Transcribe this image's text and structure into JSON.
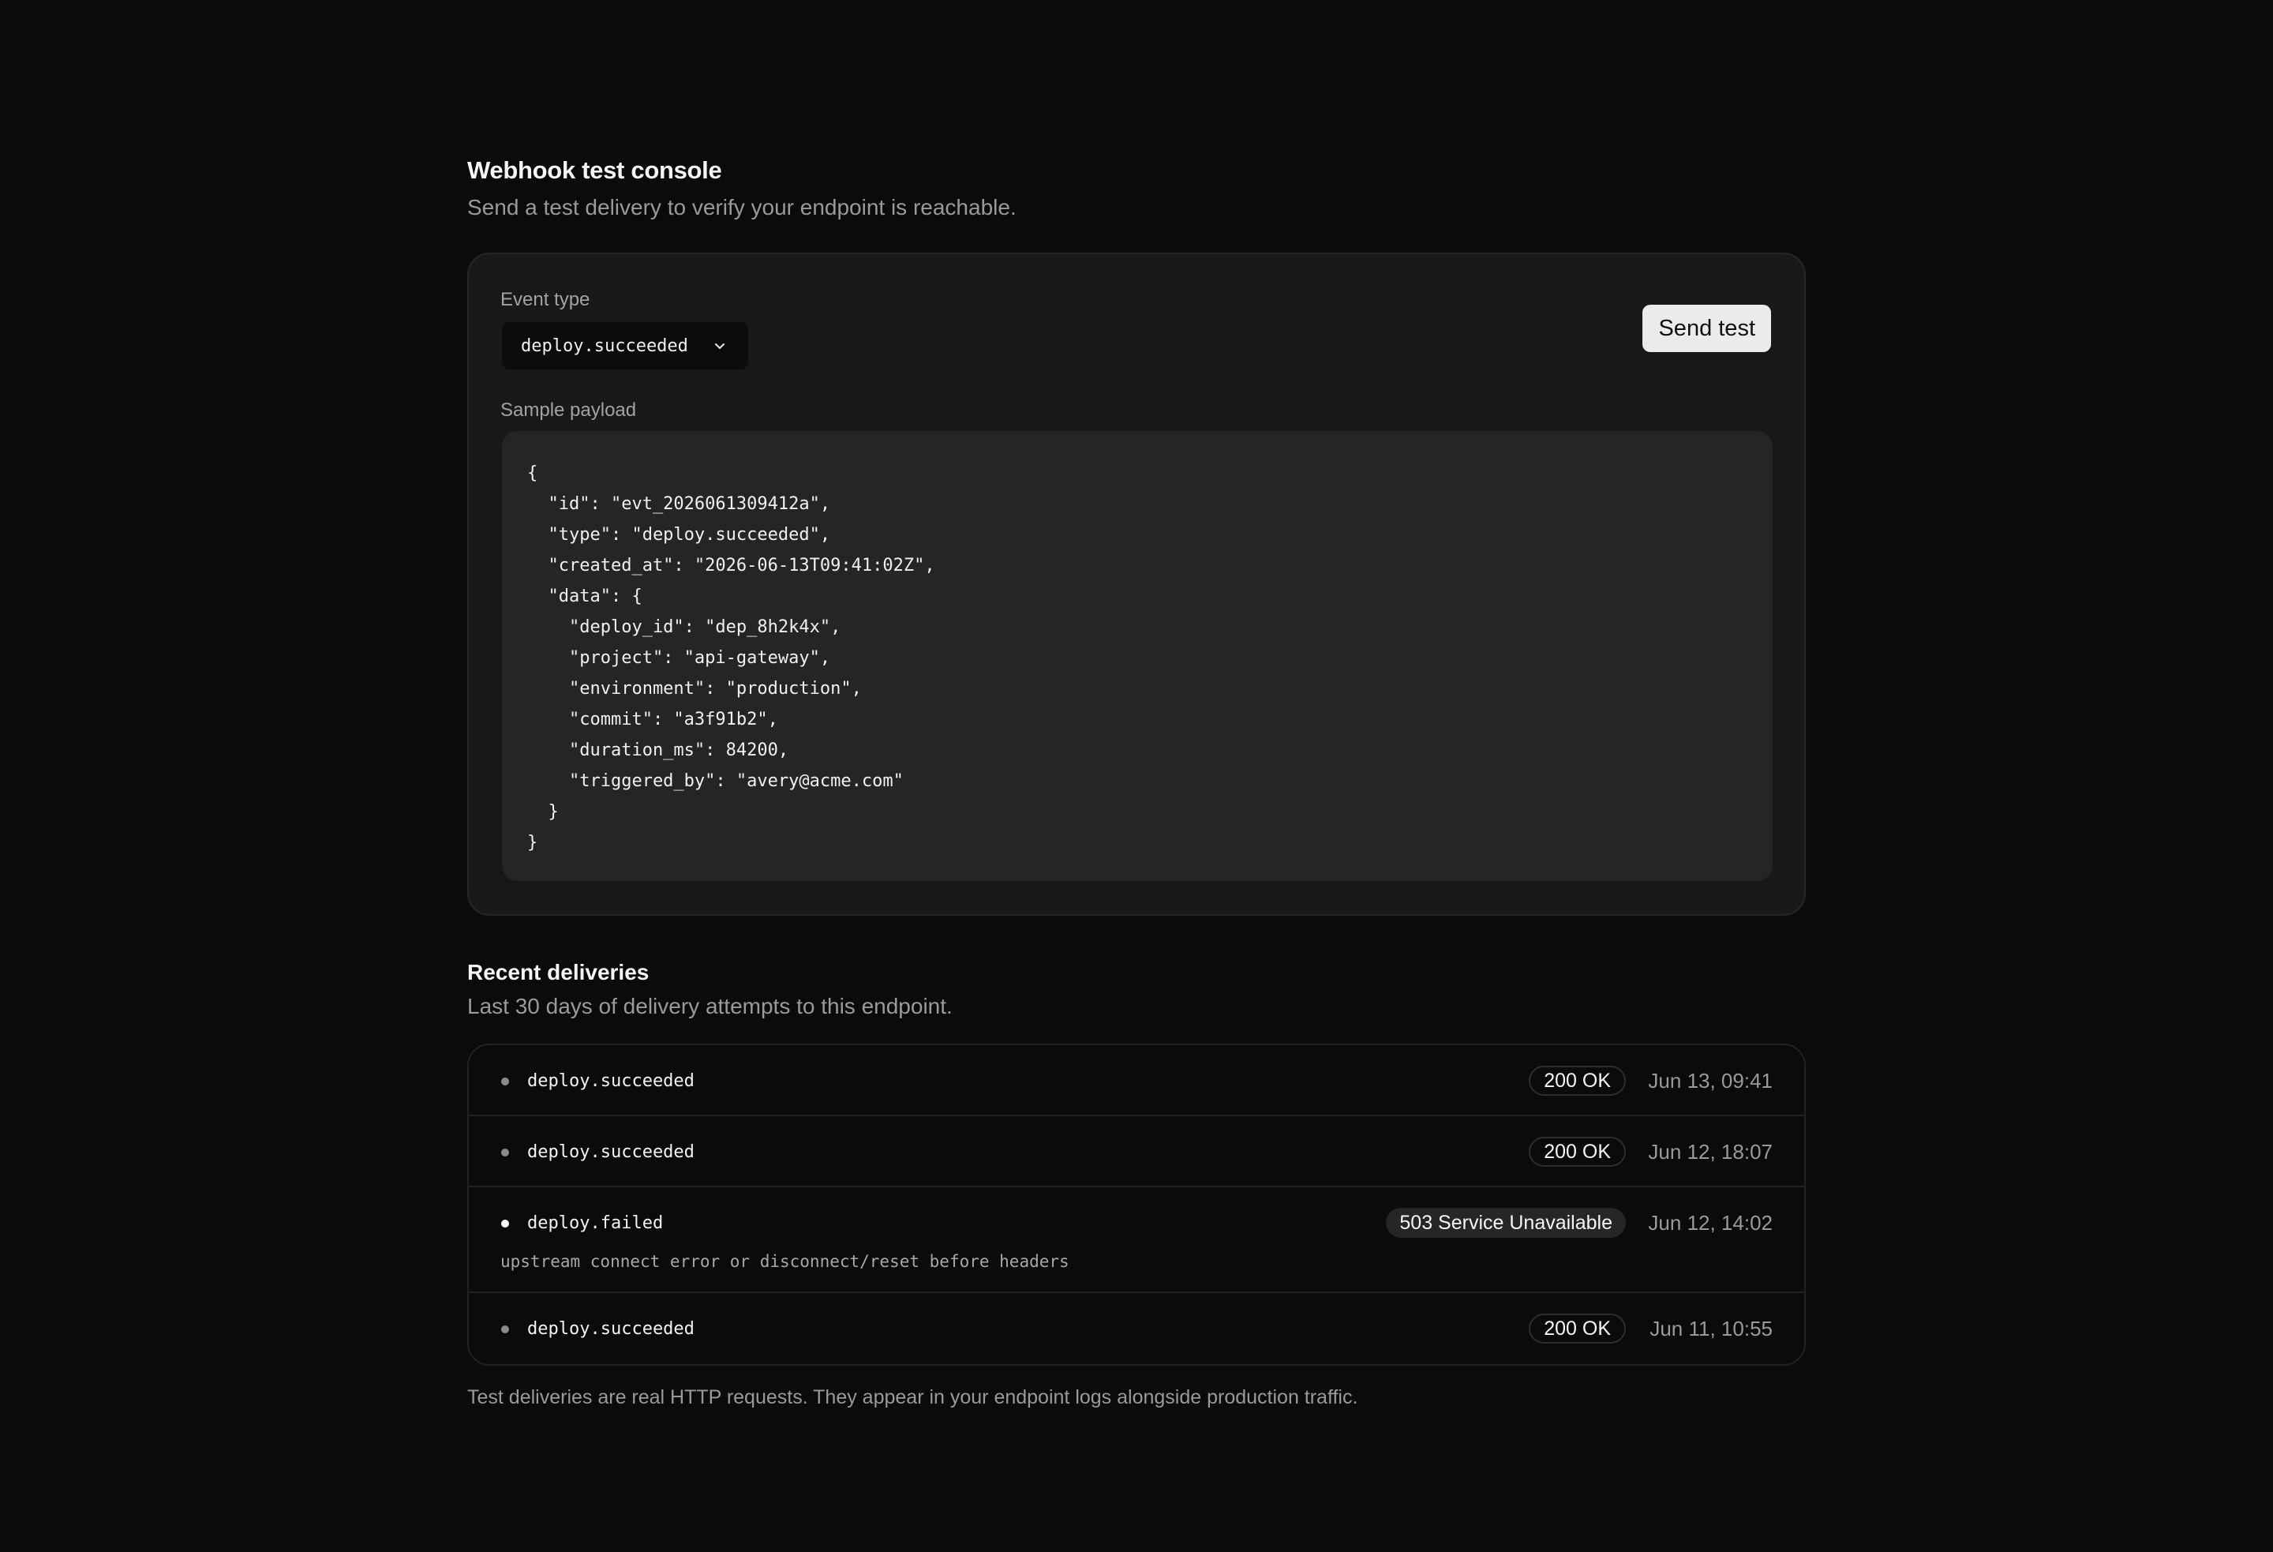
{
  "header": {
    "title": "Webhook test console",
    "subtitle": "Send a test delivery to verify your endpoint is reachable."
  },
  "console": {
    "event_type_label": "Event type",
    "event_type_value": "deploy.succeeded",
    "send_button_label": "Send test",
    "payload_label": "Sample payload",
    "payload": "{\n  \"id\": \"evt_2026061309412a\",\n  \"type\": \"deploy.succeeded\",\n  \"created_at\": \"2026-06-13T09:41:02Z\",\n  \"data\": {\n    \"deploy_id\": \"dep_8h2k4x\",\n    \"project\": \"api-gateway\",\n    \"environment\": \"production\",\n    \"commit\": \"a3f91b2\",\n    \"duration_ms\": 84200,\n    \"triggered_by\": \"avery@acme.com\"\n  }\n}"
  },
  "deliveries": {
    "title": "Recent deliveries",
    "subtitle": "Last 30 days of delivery attempts to this endpoint.",
    "rows": [
      {
        "event": "deploy.succeeded",
        "status": "200 OK",
        "time": "Jun 13, 09:41"
      },
      {
        "event": "deploy.succeeded",
        "status": "200 OK",
        "time": "Jun 12, 18:07"
      },
      {
        "event": "deploy.failed",
        "status": "503 Service Unavailable",
        "time": "Jun 12, 14:02",
        "error": "upstream connect error or disconnect/reset before headers"
      },
      {
        "event": "deploy.succeeded",
        "status": "200 OK",
        "time": "Jun 11, 10:55"
      }
    ]
  },
  "footer": {
    "note": "Test deliveries are real HTTP requests. They appear in your endpoint logs alongside production traffic."
  },
  "icons": {
    "select_chevron": "chevron-down-icon",
    "status_dot": "status-dot-icon"
  }
}
